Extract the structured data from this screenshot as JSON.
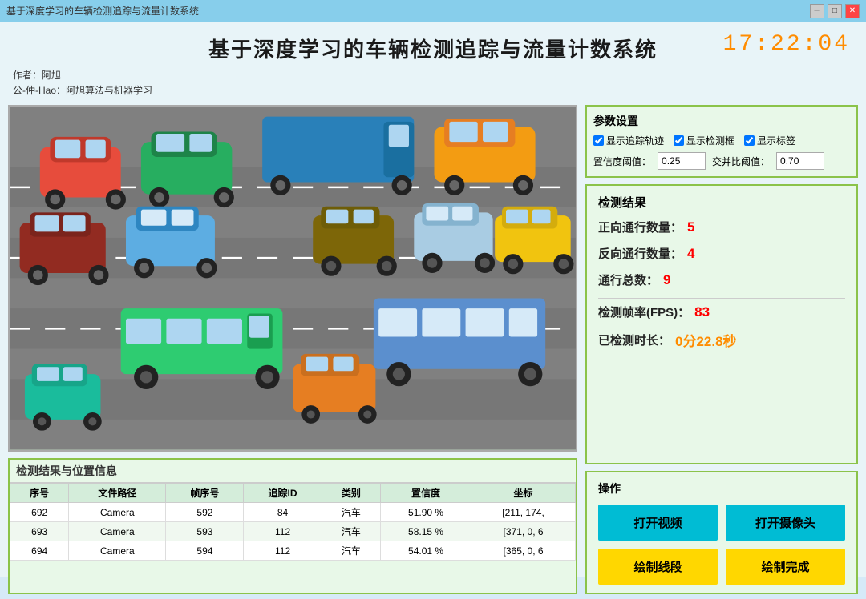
{
  "titleBar": {
    "text": "基于深度学习的车辆检测追踪与流量计数系统",
    "minimizeLabel": "─",
    "maximizeLabel": "□",
    "closeLabel": "✕"
  },
  "header": {
    "title": "基于深度学习的车辆检测追踪与流量计数系统",
    "author": "作者：阿旭",
    "channel": "公-仲-Hao：阿旭算法与机器学习",
    "clock": "17:22:04"
  },
  "params": {
    "sectionTitle": "参数设置",
    "showTrack": true,
    "showTrackLabel": "显示追踪轨迹",
    "showDetection": true,
    "showDetectionLabel": "显示检测框",
    "showLabel": true,
    "showLabelLabel": "显示标签",
    "confidenceLabel": "置信度阈值：",
    "confidenceValue": "0.25",
    "iouLabel": "交并比阈值：",
    "iouValue": "0.70"
  },
  "results": {
    "sectionTitle": "检测结果",
    "forwardLabel": "正向通行数量：",
    "forwardValue": "5",
    "reverseLabel": "反向通行数量：",
    "reverseValue": "4",
    "totalLabel": "通行总数：",
    "totalValue": "9",
    "fpsLabel": "检测帧率(FPS)：",
    "fpsValue": "83",
    "durationLabel": "已检测时长：",
    "durationValue": "0分22.8秒"
  },
  "operations": {
    "sectionTitle": "操作",
    "openVideoLabel": "打开视频",
    "openCameraLabel": "打开摄像头",
    "drawLineLabel": "绘制线段",
    "drawCompleteLabel": "绘制完成"
  },
  "detectionTable": {
    "sectionTitle": "检测结果与位置信息",
    "columns": [
      "序号",
      "文件路径",
      "帧序号",
      "追踪ID",
      "类别",
      "置信度",
      "坐标"
    ],
    "rows": [
      {
        "id": "692",
        "path": "Camera",
        "frame": "592",
        "trackId": "84",
        "category": "汽车",
        "confidence": "51.90 %",
        "coords": "[211, 174,"
      },
      {
        "id": "693",
        "path": "Camera",
        "frame": "593",
        "trackId": "112",
        "category": "汽车",
        "confidence": "58.15 %",
        "coords": "[371, 0, 6"
      },
      {
        "id": "694",
        "path": "Camera",
        "frame": "594",
        "trackId": "112",
        "category": "汽车",
        "confidence": "54.01 %",
        "coords": "[365, 0, 6"
      }
    ]
  }
}
